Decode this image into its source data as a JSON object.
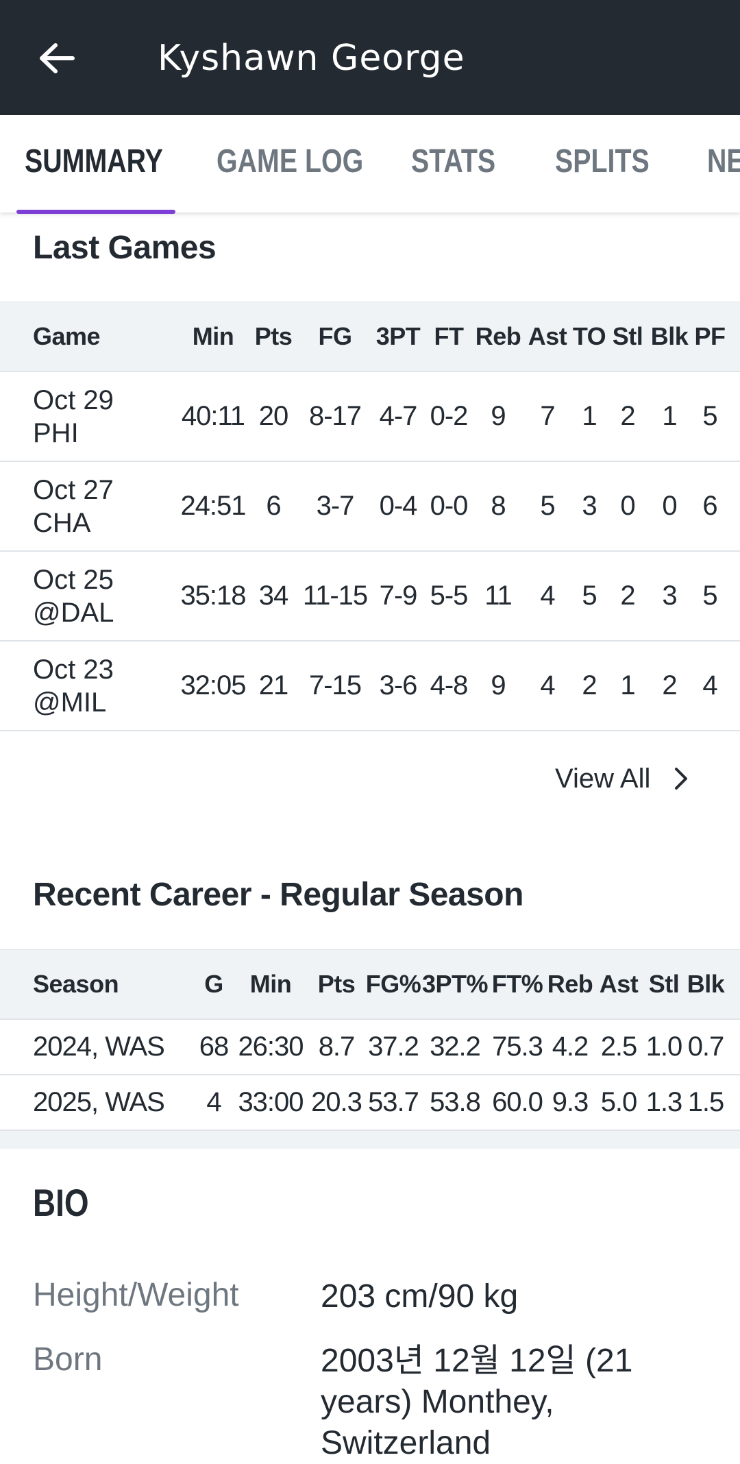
{
  "header": {
    "title": "Kyshawn George",
    "back_icon": "arrow-left-icon",
    "background": "#232a31"
  },
  "tabs": {
    "items": [
      {
        "label": "SUMMARY",
        "active": true
      },
      {
        "label": "GAME LOG",
        "active": false
      },
      {
        "label": "STATS",
        "active": false
      },
      {
        "label": "SPLITS",
        "active": false
      },
      {
        "label": "NE",
        "active": false
      }
    ],
    "indicator_color": "#7e3fd6"
  },
  "last_games": {
    "title": "Last Games",
    "columns": [
      "Game",
      "Min",
      "Pts",
      "FG",
      "3PT",
      "FT",
      "Reb",
      "Ast",
      "TO",
      "Stl",
      "Blk",
      "PF"
    ],
    "rows": [
      {
        "date": "Oct 29",
        "opp": "PHI",
        "stats": [
          "40:11",
          "20",
          "8-17",
          "4-7",
          "0-2",
          "9",
          "7",
          "1",
          "2",
          "1",
          "5"
        ]
      },
      {
        "date": "Oct 27",
        "opp": "CHA",
        "stats": [
          "24:51",
          "6",
          "3-7",
          "0-4",
          "0-0",
          "8",
          "5",
          "3",
          "0",
          "0",
          "6"
        ]
      },
      {
        "date": "Oct 25",
        "opp": "@DAL",
        "stats": [
          "35:18",
          "34",
          "11-15",
          "7-9",
          "5-5",
          "11",
          "4",
          "5",
          "2",
          "3",
          "5"
        ]
      },
      {
        "date": "Oct 23",
        "opp": "@MIL",
        "stats": [
          "32:05",
          "21",
          "7-15",
          "3-6",
          "4-8",
          "9",
          "4",
          "2",
          "1",
          "2",
          "4"
        ]
      }
    ],
    "view_all_label": "View All"
  },
  "career": {
    "title": "Recent Career - Regular Season",
    "columns": [
      "Season",
      "G",
      "Min",
      "Pts",
      "FG%",
      "3PT%",
      "FT%",
      "Reb",
      "Ast",
      "Stl",
      "Blk"
    ],
    "rows": [
      [
        "2024, WAS",
        "68",
        "26:30",
        "8.7",
        "37.2",
        "32.2",
        "75.3",
        "4.2",
        "2.5",
        "1.0",
        "0.7"
      ],
      [
        "2025, WAS",
        "4",
        "33:00",
        "20.3",
        "53.7",
        "53.8",
        "60.0",
        "9.3",
        "5.0",
        "1.3",
        "1.5"
      ]
    ]
  },
  "bio": {
    "title": "BIO",
    "items": [
      {
        "label": "Height/Weight",
        "value": "203 cm/90 kg"
      },
      {
        "label": "Born",
        "value": "2003년 12월 12일 (21 years) Monthey, Switzerland"
      }
    ]
  }
}
